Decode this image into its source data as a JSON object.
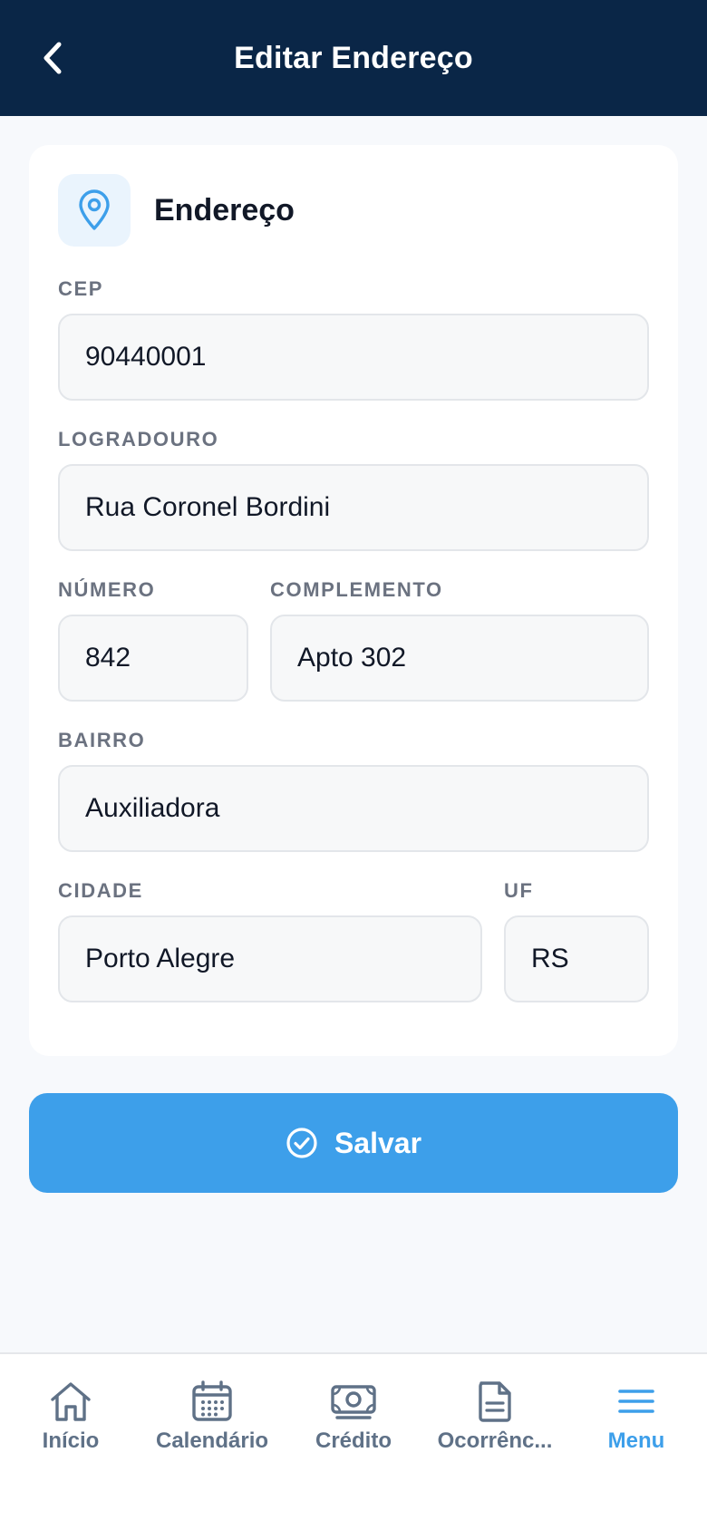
{
  "header": {
    "title": "Editar Endereço"
  },
  "card": {
    "title": "Endereço"
  },
  "fields": {
    "cep": {
      "label": "CEP",
      "value": "90440001"
    },
    "logradouro": {
      "label": "LOGRADOURO",
      "value": "Rua Coronel Bordini"
    },
    "numero": {
      "label": "NÚMERO",
      "value": "842"
    },
    "complemento": {
      "label": "COMPLEMENTO",
      "value": "Apto 302"
    },
    "bairro": {
      "label": "BAIRRO",
      "value": "Auxiliadora"
    },
    "cidade": {
      "label": "CIDADE",
      "value": "Porto Alegre"
    },
    "uf": {
      "label": "UF",
      "value": "RS"
    }
  },
  "actions": {
    "save_label": "Salvar"
  },
  "tabs": [
    {
      "label": "Início",
      "icon": "home-icon"
    },
    {
      "label": "Calendário",
      "icon": "calendar-icon"
    },
    {
      "label": "Crédito",
      "icon": "money-icon"
    },
    {
      "label": "Ocorrênc...",
      "icon": "document-icon"
    },
    {
      "label": "Menu",
      "icon": "menu-icon",
      "active": true
    }
  ],
  "colors": {
    "header_bg": "#0a2647",
    "accent": "#3d9fea",
    "tab_inactive": "#5f7187"
  }
}
